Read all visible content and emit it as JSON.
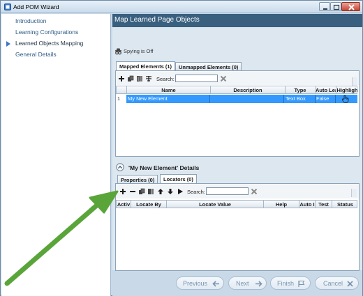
{
  "window": {
    "title": "Add POM Wizard"
  },
  "nav": {
    "items": [
      {
        "label": "Introduction",
        "current": false
      },
      {
        "label": "Learning Configurations",
        "current": false
      },
      {
        "label": "Learned Objects Mapping",
        "current": true
      },
      {
        "label": "General Details",
        "current": false
      }
    ]
  },
  "page": {
    "title": "Map Learned Page Objects"
  },
  "spy": {
    "label": "Spying is Off"
  },
  "elements_tabs": [
    {
      "label": "Mapped Elements (1)",
      "active": true
    },
    {
      "label": "Unmapped Elements (0)",
      "active": false
    }
  ],
  "elements_toolbar": {
    "search_label": "Search:",
    "search_value": ""
  },
  "elements_grid": {
    "columns": [
      "Name",
      "Description",
      "Type",
      "Auto Lea",
      "Highligh"
    ],
    "rows": [
      {
        "index": "1",
        "name": "My New Element",
        "description": "",
        "type": "Text Box",
        "auto_learn": "False",
        "highlight": "hand-pointer-icon"
      }
    ]
  },
  "details": {
    "title": "'My New Element' Details"
  },
  "details_tabs": [
    {
      "label": "Properties (0)",
      "active": false
    },
    {
      "label": "Locators (0)",
      "active": true
    }
  ],
  "locators_toolbar": {
    "search_label": "Search:",
    "search_value": ""
  },
  "locators_grid": {
    "columns": [
      "Activ",
      "Locate By",
      "Locate Value",
      "Help",
      "Auto I",
      "Test",
      "Status"
    ],
    "rows": []
  },
  "footer": {
    "previous": "Previous",
    "next": "Next",
    "finish": "Finish",
    "cancel": "Cancel"
  },
  "colors": {
    "header_bg": "#39607f",
    "selection": "#3399ff",
    "annotation_arrow": "#5aa53a"
  }
}
